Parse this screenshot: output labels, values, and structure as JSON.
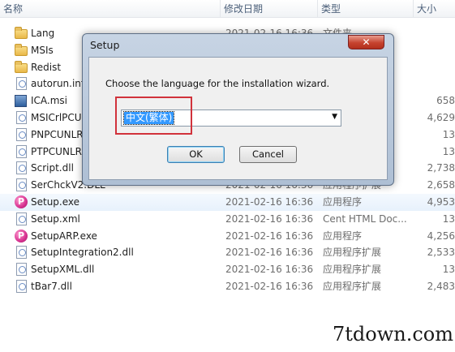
{
  "columns": {
    "name": "名称",
    "date": "修改日期",
    "type": "类型",
    "size": "大小"
  },
  "rows": [
    {
      "name": "Lang",
      "date": "2021-02-16 16:36",
      "type": "文件夹",
      "size": "",
      "icon": "folder-icon"
    },
    {
      "name": "MSIs",
      "date": "",
      "type": "",
      "size": "",
      "icon": "folder-icon"
    },
    {
      "name": "Redist",
      "date": "",
      "type": "",
      "size": "",
      "icon": "folder-icon"
    },
    {
      "name": "autorun.inf",
      "date": "",
      "type": "",
      "size": "",
      "icon": "file-icon"
    },
    {
      "name": "ICA.msi",
      "date": "",
      "type": "",
      "size": "658",
      "icon": "installer-icon"
    },
    {
      "name": "MSICrlPCU",
      "date": "",
      "type": "",
      "size": "4,629",
      "icon": "file-icon"
    },
    {
      "name": "PNPCUNLR",
      "date": "",
      "type": "",
      "size": "13",
      "icon": "file-icon"
    },
    {
      "name": "PTPCUNLR",
      "date": "",
      "type": "",
      "size": "13",
      "icon": "file-icon"
    },
    {
      "name": "Script.dll",
      "date": "",
      "type": "",
      "size": "2,738",
      "icon": "file-icon"
    },
    {
      "name": "SerChckV2.DLL",
      "date": "2021-02-16 16:36",
      "type": "应用程序扩展",
      "size": "2,658",
      "icon": "file-icon"
    },
    {
      "name": "Setup.exe",
      "date": "2021-02-16 16:36",
      "type": "应用程序",
      "size": "4,953",
      "icon": "setup-exe-icon",
      "selected": true
    },
    {
      "name": "Setup.xml",
      "date": "2021-02-16 16:36",
      "type": "Cent HTML Doc...",
      "size": "13",
      "icon": "file-icon"
    },
    {
      "name": "SetupARP.exe",
      "date": "2021-02-16 16:36",
      "type": "应用程序",
      "size": "4,256",
      "icon": "setup-exe-icon"
    },
    {
      "name": "SetupIntegration2.dll",
      "date": "2021-02-16 16:36",
      "type": "应用程序扩展",
      "size": "2,533",
      "icon": "file-icon"
    },
    {
      "name": "SetupXML.dll",
      "date": "2021-02-16 16:36",
      "type": "应用程序扩展",
      "size": "13",
      "icon": "file-icon"
    },
    {
      "name": "tBar7.dll",
      "date": "2021-02-16 16:36",
      "type": "应用程序扩展",
      "size": "2,483",
      "icon": "file-icon"
    }
  ],
  "dialog": {
    "title": "Setup",
    "close_glyph": "✕",
    "message": "Choose the language for the installation wizard.",
    "selected_language": "中文(繁体)",
    "ok_label": "OK",
    "cancel_label": "Cancel"
  },
  "watermark": "7tdown.com",
  "colors": {
    "highlight_box": "#d1323b",
    "selection": "#3399ff"
  }
}
